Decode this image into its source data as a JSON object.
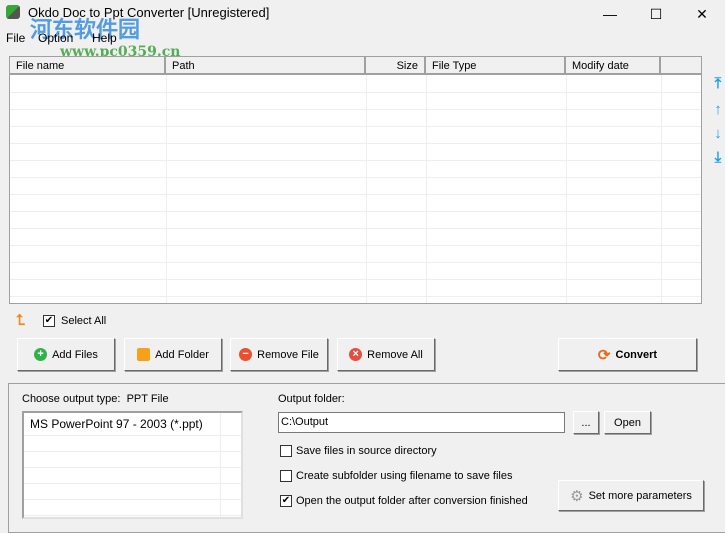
{
  "window": {
    "title": "Okdo Doc to Ppt Converter [Unregistered]",
    "minimize": "—",
    "maximize": "☐",
    "close": "✕"
  },
  "watermark": {
    "name": "河东软件园",
    "url": "www.pc0359.cn"
  },
  "menu": [
    "File",
    "Option",
    "Help"
  ],
  "table": {
    "columns": [
      "File name",
      "Path",
      "Size",
      "File Type",
      "Modify date",
      ""
    ],
    "rows": []
  },
  "select_all": {
    "label": "Select All",
    "checked": true
  },
  "buttons": {
    "add_files": "Add Files",
    "add_folder": "Add Folder",
    "remove_file": "Remove File",
    "remove_all": "Remove All",
    "convert": "Convert",
    "browse": "...",
    "open": "Open",
    "set_params": "Set more parameters"
  },
  "output": {
    "type_label": "Choose output type:",
    "type_value": "PPT File",
    "formats": [
      "MS PowerPoint 97 - 2003 (*.ppt)"
    ],
    "folder_label": "Output folder:",
    "folder_value": "C:\\Output"
  },
  "options": [
    {
      "label": "Save files in source directory",
      "checked": false
    },
    {
      "label": "Create subfolder using filename to save files",
      "checked": false
    },
    {
      "label": "Open the output folder after conversion finished",
      "checked": true
    }
  ]
}
